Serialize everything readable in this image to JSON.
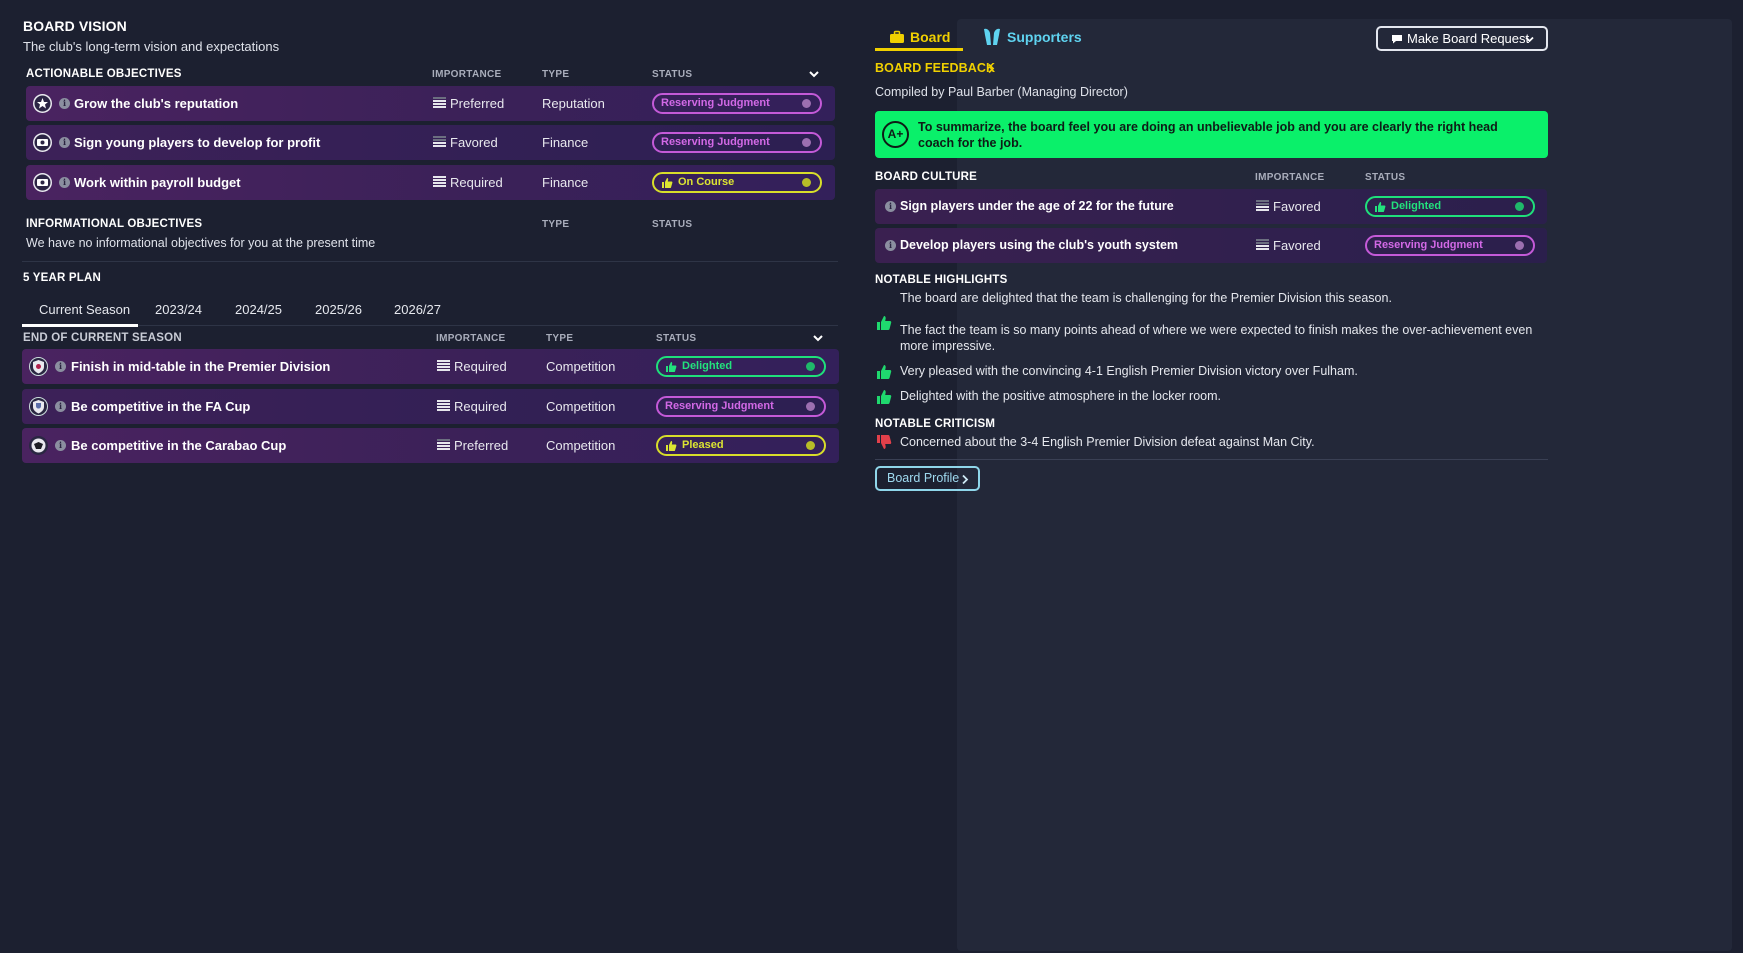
{
  "vision": {
    "title": "BOARD VISION",
    "subtitle": "The club's long-term vision and expectations"
  },
  "actionable": {
    "header": "ACTIONABLE OBJECTIVES",
    "col_importance": "IMPORTANCE",
    "col_type": "TYPE",
    "col_status": "STATUS",
    "rows": [
      {
        "label": "Grow the club's reputation",
        "importance": "Preferred",
        "type": "Reputation",
        "status": "Reserving Judgment",
        "status_color": "purple",
        "icon": "star-badge-icon"
      },
      {
        "label": "Sign young players to develop for profit",
        "importance": "Favored",
        "type": "Finance",
        "status": "Reserving Judgment",
        "status_color": "purple",
        "icon": "money-icon"
      },
      {
        "label": "Work within payroll budget",
        "importance": "Required",
        "type": "Finance",
        "status": "On Course",
        "status_color": "yellow",
        "icon": "money-icon"
      }
    ]
  },
  "informational": {
    "header": "INFORMATIONAL OBJECTIVES",
    "col_type": "TYPE",
    "col_status": "STATUS",
    "empty_text": "We have no informational objectives for you at the present time"
  },
  "plan": {
    "header": "5 YEAR PLAN",
    "tabs": [
      "Current Season",
      "2023/24",
      "2024/25",
      "2025/26",
      "2026/27"
    ],
    "section_header": "END OF CURRENT SEASON",
    "col_importance": "IMPORTANCE",
    "col_type": "TYPE",
    "col_status": "STATUS",
    "rows": [
      {
        "label": "Finish in mid-table in the Premier Division",
        "importance": "Required",
        "type": "Competition",
        "status": "Delighted",
        "status_color": "green",
        "icon": "league-crest-icon"
      },
      {
        "label": "Be competitive in the FA Cup",
        "importance": "Required",
        "type": "Competition",
        "status": "Reserving Judgment",
        "status_color": "purple",
        "icon": "cup-crest-icon"
      },
      {
        "label": "Be competitive in the Carabao Cup",
        "importance": "Preferred",
        "type": "Competition",
        "status": "Pleased",
        "status_color": "yellow",
        "icon": "carabao-crest-icon"
      }
    ]
  },
  "right": {
    "tab_board": "Board",
    "tab_supporters": "Supporters",
    "request_button": "Make Board Request",
    "feedback_title": "BOARD FEEDBACK",
    "compiled_by": "Compiled by Paul Barber (Managing Director)",
    "grade": "A+",
    "grade_text": "To summarize, the board feel you are doing an unbelievable job and you are clearly the right head coach for the job.",
    "culture_header": "BOARD CULTURE",
    "culture_col_importance": "IMPORTANCE",
    "culture_col_status": "STATUS",
    "culture_rows": [
      {
        "label": "Sign players under the age of 22 for the future",
        "importance": "Favored",
        "status": "Delighted",
        "status_color": "green"
      },
      {
        "label": "Develop players using the club's youth system",
        "importance": "Favored",
        "status": "Reserving Judgment",
        "status_color": "purple"
      }
    ],
    "highlights_header": "NOTABLE HIGHLIGHTS",
    "highlights": [
      "The board are delighted that the team is challenging for the Premier Division this season.",
      "The fact the team is so many points ahead of where we were expected to finish makes the over-achievement even more impressive.",
      "Very pleased with the convincing 4-1 English Premier Division victory over Fulham.",
      "Delighted with the positive atmosphere in the locker room."
    ],
    "criticism_header": "NOTABLE CRITICISM",
    "criticism": [
      "Concerned about the 3-4 English Premier Division defeat against Man City."
    ],
    "profile_button": "Board Profile",
    "accent_green": "#0af06a",
    "accent_yellow": "#f0d000",
    "accent_cyan": "#5fd3f0"
  }
}
